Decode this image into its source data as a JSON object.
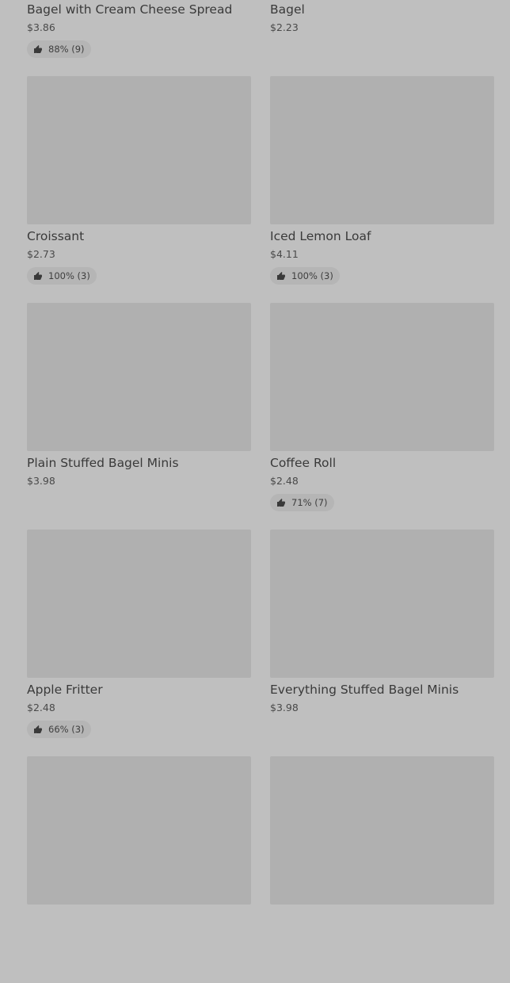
{
  "products": [
    {
      "name": "Bagel with Cream Cheese Spread",
      "price": "$3.86",
      "rating": "88% (9)"
    },
    {
      "name": "Bagel",
      "price": "$2.23",
      "rating": ""
    },
    {
      "name": "Croissant",
      "price": "$2.73",
      "rating": "100% (3)"
    },
    {
      "name": "Iced Lemon Loaf",
      "price": "$4.11",
      "rating": "100% (3)"
    },
    {
      "name": "Plain Stuffed Bagel Minis",
      "price": "$3.98",
      "rating": ""
    },
    {
      "name": "Coffee Roll",
      "price": "$2.48",
      "rating": "71% (7)"
    },
    {
      "name": "Apple Fritter",
      "price": "$2.48",
      "rating": "66% (3)"
    },
    {
      "name": "Everything Stuffed Bagel Minis",
      "price": "$3.98",
      "rating": ""
    },
    {
      "name": "",
      "price": "",
      "rating": ""
    },
    {
      "name": "",
      "price": "",
      "rating": ""
    }
  ]
}
